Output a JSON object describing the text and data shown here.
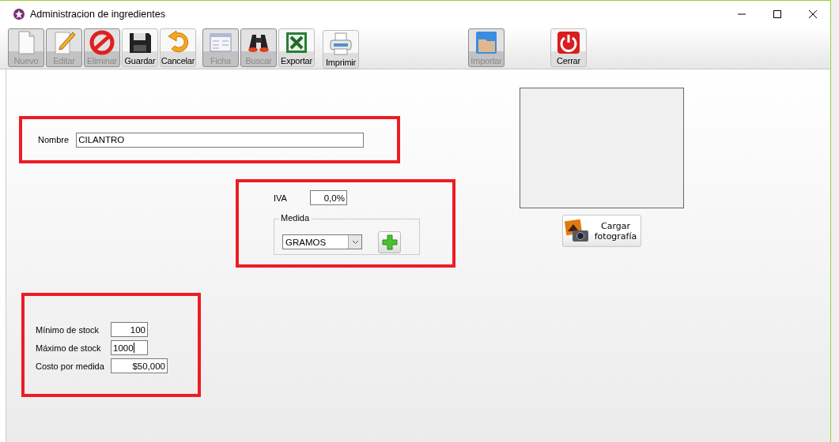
{
  "window": {
    "title": "Administracion de ingredientes"
  },
  "toolbar": {
    "groups": [
      [
        {
          "label": "Nuevo",
          "kind": "new",
          "disabled": true
        },
        {
          "label": "Editar",
          "kind": "edit",
          "disabled": true
        },
        {
          "label": "Eliminar",
          "kind": "delete",
          "disabled": true
        },
        {
          "label": "Guardar",
          "kind": "save",
          "disabled": false
        },
        {
          "label": "Cancelar",
          "kind": "cancel",
          "disabled": false
        }
      ],
      [
        {
          "label": "Ficha",
          "kind": "form",
          "disabled": true
        },
        {
          "label": "Buscar",
          "kind": "search",
          "disabled": true
        },
        {
          "label": "Exportar",
          "kind": "export",
          "disabled": false
        }
      ],
      [
        {
          "label": "Imprimir",
          "kind": "print",
          "disabled": false
        }
      ],
      [
        {
          "label": "Importar",
          "kind": "import",
          "disabled": true
        }
      ],
      [
        {
          "label": "Cerrar",
          "kind": "close",
          "disabled": false
        }
      ]
    ]
  },
  "form": {
    "nombre": {
      "label": "Nombre",
      "value": "CILANTRO"
    },
    "iva": {
      "label": "IVA",
      "value": "0,0%"
    },
    "medida": {
      "legend": "Medida",
      "value": "GRAMOS"
    },
    "stock_fields": [
      {
        "label": "Mínimo de stock",
        "value": "100",
        "focused": false
      },
      {
        "label": "Máximo de stock",
        "value": "1000",
        "focused": true
      },
      {
        "label": "Costo por medida",
        "value": "$50,000",
        "focused": false
      }
    ]
  },
  "photo": {
    "button": "Cargar fotografía"
  }
}
